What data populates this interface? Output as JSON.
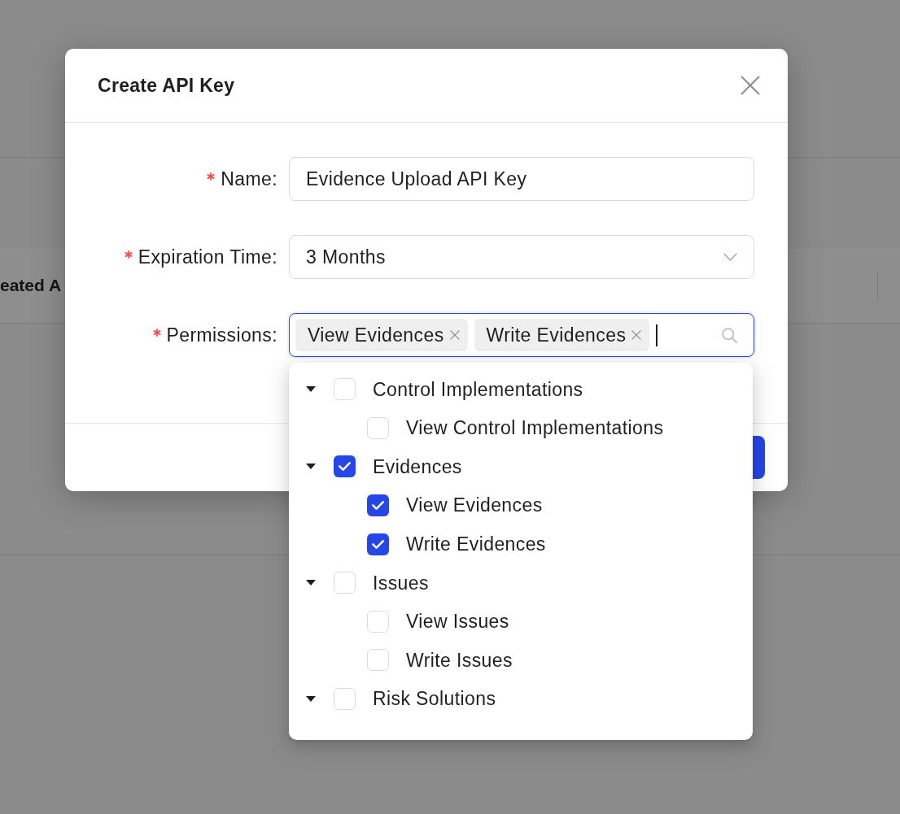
{
  "background": {
    "column_header": "eated A"
  },
  "dialog": {
    "title": "Create API Key",
    "fields": [
      {
        "kind": "text",
        "label": "Name:",
        "required": true,
        "focused": false,
        "value": "Evidence Upload API Key"
      },
      {
        "kind": "select",
        "label": "Expiration Time:",
        "required": true,
        "focused": false,
        "value": "3 Months"
      },
      {
        "kind": "tags",
        "label": "Permissions:",
        "required": true,
        "focused": true,
        "tags": [
          "View Evidences",
          "Write Evidences"
        ]
      }
    ]
  },
  "permission_tree": [
    {
      "label": "Control Implementations",
      "checked": false,
      "expanded": true,
      "children": [
        {
          "label": "View Control Implementations",
          "checked": false
        }
      ]
    },
    {
      "label": "Evidences",
      "checked": true,
      "expanded": true,
      "children": [
        {
          "label": "View Evidences",
          "checked": true
        },
        {
          "label": "Write Evidences",
          "checked": true
        }
      ]
    },
    {
      "label": "Issues",
      "checked": false,
      "expanded": true,
      "children": [
        {
          "label": "View Issues",
          "checked": false
        },
        {
          "label": "Write Issues",
          "checked": false
        }
      ]
    },
    {
      "label": "Risk Solutions",
      "checked": false,
      "expanded": true
    }
  ]
}
